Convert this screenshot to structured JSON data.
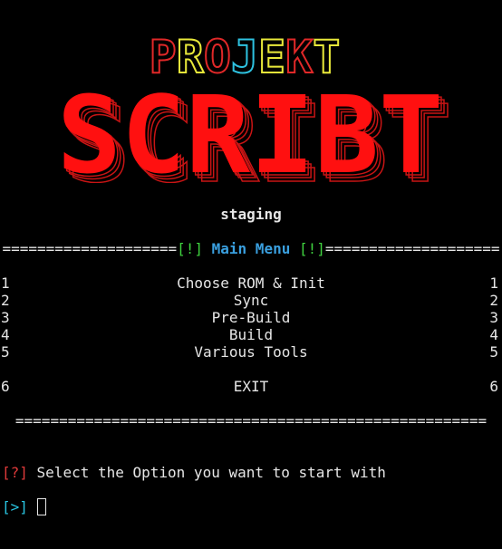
{
  "logo": {
    "top_word": "PROJEKT",
    "main_word": "SCRIBT",
    "top_colors": [
      "#e02828",
      "#e8e83a",
      "#e02828",
      "#2ec2e0",
      "#e8e83a",
      "#e02828",
      "#e8e83a"
    ],
    "main_color": "#ff1010",
    "shadow_color": "#c81414"
  },
  "subtitle": "staging",
  "menu_header": {
    "marker_left": "[!]",
    "title": "Main Menu",
    "marker_right": "[!]",
    "fill": "===================="
  },
  "menu_items": [
    {
      "num": "1",
      "label": "Choose ROM & Init"
    },
    {
      "num": "2",
      "label": "Sync"
    },
    {
      "num": "3",
      "label": "Pre-Build"
    },
    {
      "num": "4",
      "label": "Build"
    },
    {
      "num": "5",
      "label": "Various Tools"
    }
  ],
  "exit_item": {
    "num": "6",
    "label": "EXIT"
  },
  "separator": "======================================================",
  "prompt": {
    "marker": "[?]",
    "text": " Select the Option you want to start with"
  },
  "input_prompt": {
    "marker": "[>]"
  }
}
